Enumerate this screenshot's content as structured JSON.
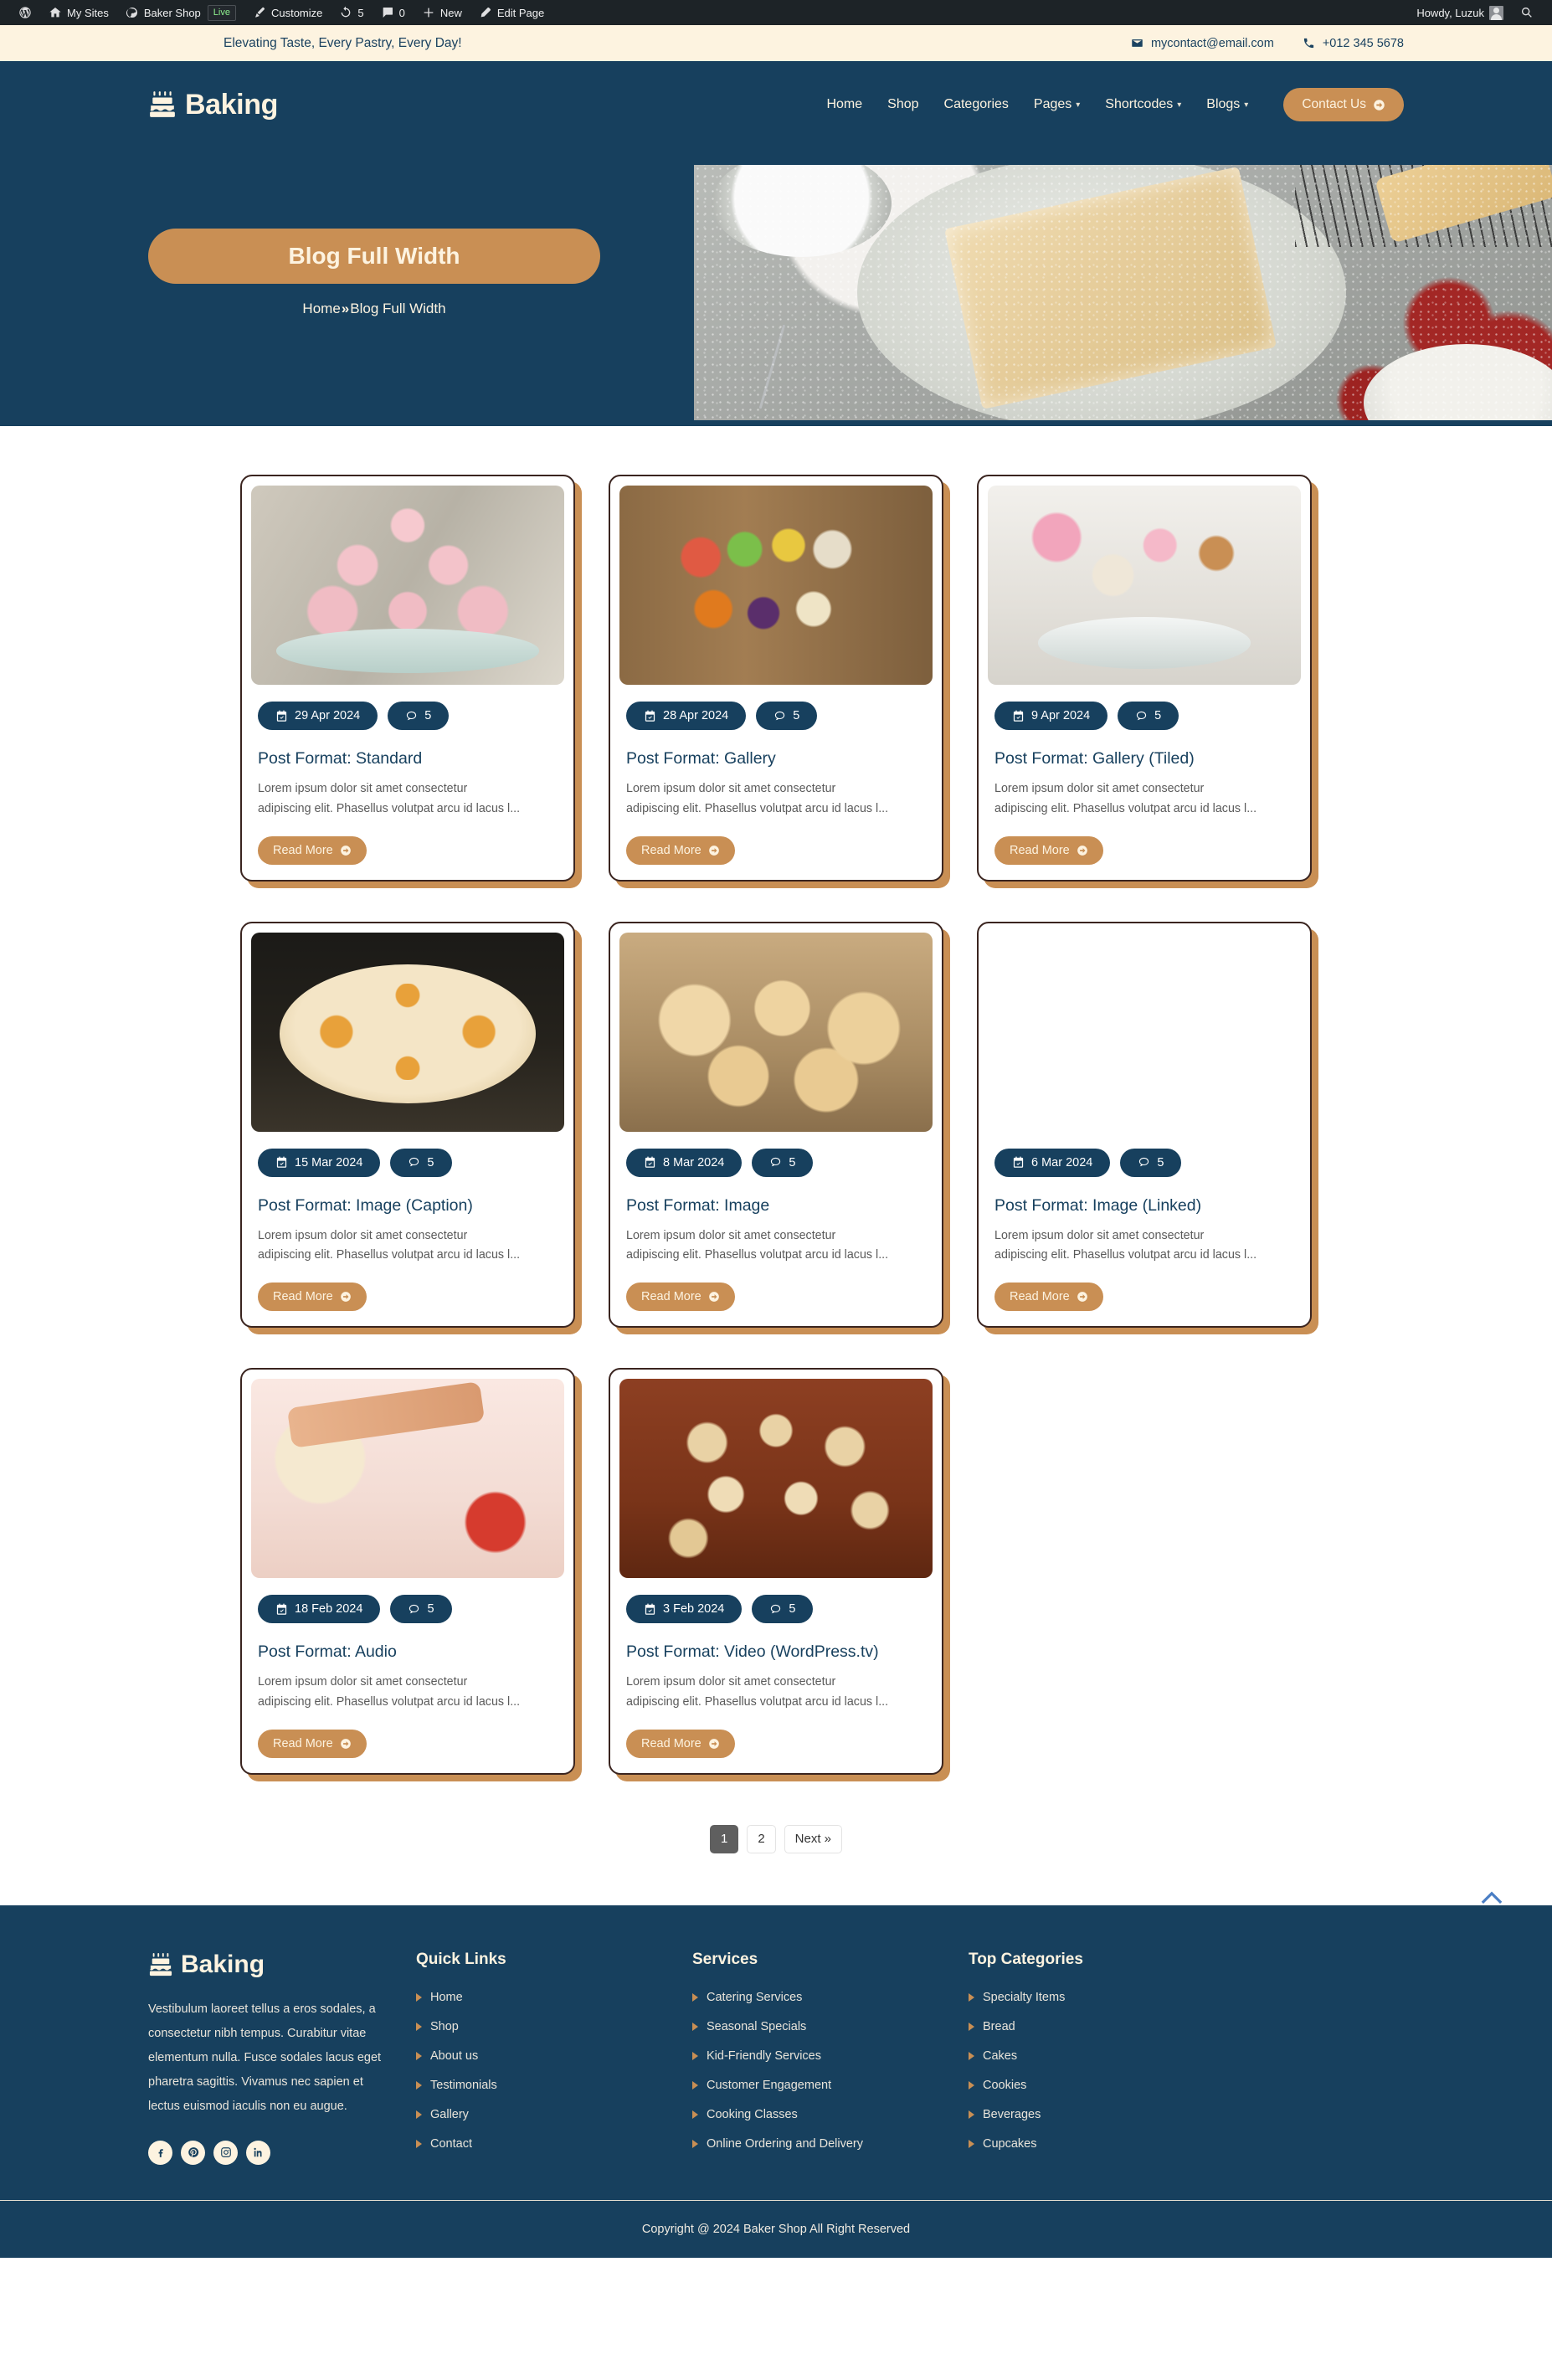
{
  "adminbar": {
    "items": [
      {
        "name": "wordpress-logo",
        "label": ""
      },
      {
        "name": "my-sites",
        "label": "My Sites"
      },
      {
        "name": "site-name",
        "label": "Baker Shop"
      },
      {
        "name": "live-badge",
        "label": "Live"
      },
      {
        "name": "customize",
        "label": "Customize"
      },
      {
        "name": "updates",
        "label": "5"
      },
      {
        "name": "comments",
        "label": "0"
      },
      {
        "name": "new",
        "label": "New"
      },
      {
        "name": "edit-page",
        "label": "Edit Page"
      }
    ],
    "howdy": "Howdy, Luzuk"
  },
  "topbar": {
    "tagline": "Elevating Taste, Every Pastry, Every Day!",
    "email": "mycontact@email.com",
    "phone": "+012 345 5678"
  },
  "header": {
    "brand": "Baking",
    "nav": [
      {
        "label": "Home",
        "has_caret": false
      },
      {
        "label": "Shop",
        "has_caret": false
      },
      {
        "label": "Categories",
        "has_caret": false
      },
      {
        "label": "Pages",
        "has_caret": true
      },
      {
        "label": "Shortcodes",
        "has_caret": true
      },
      {
        "label": "Blogs",
        "has_caret": true
      }
    ],
    "cta": "Contact Us"
  },
  "hero": {
    "title": "Blog Full Width",
    "breadcrumb_home": "Home",
    "breadcrumb_sep": "»",
    "breadcrumb_current": "Blog Full Width"
  },
  "posts": [
    {
      "date": "29 Apr 2024",
      "comments": "5",
      "title": "Post Format: Standard",
      "excerpt": "Lorem ipsum dolor sit amet consectetur adipiscing elit. Phasellus volutpat arcu id lacus l...",
      "read_more": "Read More",
      "photo": "ph-cupcakes"
    },
    {
      "date": "28 Apr 2024",
      "comments": "5",
      "title": "Post Format: Gallery",
      "excerpt": "Lorem ipsum dolor sit amet consectetur adipiscing elit. Phasellus volutpat arcu id lacus l...",
      "read_more": "Read More",
      "photo": "ph-macaron"
    },
    {
      "date": "9 Apr 2024",
      "comments": "5",
      "title": "Post Format: Gallery (Tiled)",
      "excerpt": "Lorem ipsum dolor sit amet consectetur adipiscing elit. Phasellus volutpat arcu id lacus l...",
      "read_more": "Read More",
      "photo": "ph-tiled"
    },
    {
      "date": "15 Mar 2024",
      "comments": "5",
      "title": "Post Format: Image (Caption)",
      "excerpt": "Lorem ipsum dolor sit amet consectetur adipiscing elit. Phasellus volutpat arcu id lacus l...",
      "read_more": "Read More",
      "photo": "ph-cake"
    },
    {
      "date": "8 Mar 2024",
      "comments": "5",
      "title": "Post Format: Image",
      "excerpt": "Lorem ipsum dolor sit amet consectetur adipiscing elit. Phasellus volutpat arcu id lacus l...",
      "read_more": "Read More",
      "photo": "ph-pastry"
    },
    {
      "date": "6 Mar 2024",
      "comments": "5",
      "title": "Post Format: Image (Linked)",
      "excerpt": "Lorem ipsum dolor sit amet consectetur adipiscing elit. Phasellus volutpat arcu id lacus l...",
      "read_more": "Read More",
      "photo": "ph-blue"
    },
    {
      "date": "18 Feb 2024",
      "comments": "5",
      "title": "Post Format: Audio",
      "excerpt": "Lorem ipsum dolor sit amet consectetur adipiscing elit. Phasellus volutpat arcu id lacus l...",
      "read_more": "Read More",
      "photo": "ph-dough"
    },
    {
      "date": "3 Feb 2024",
      "comments": "5",
      "title": "Post Format: Video (WordPress.tv)",
      "excerpt": "Lorem ipsum dolor sit amet consectetur adipiscing elit. Phasellus volutpat arcu id lacus l...",
      "read_more": "Read More",
      "photo": "ph-cookies"
    }
  ],
  "pagination": {
    "pages": [
      "1",
      "2"
    ],
    "active": "1",
    "next": "Next »"
  },
  "footer": {
    "brand": "Baking",
    "about": "Vestibulum laoreet tellus a eros sodales, a consectetur nibh tempus. Curabitur vitae elementum nulla. Fusce sodales lacus eget pharetra sagittis. Vivamus nec sapien et lectus euismod iaculis non eu augue.",
    "socials": [
      "facebook-icon",
      "pinterest-icon",
      "instagram-icon",
      "linkedin-icon"
    ],
    "columns": [
      {
        "heading": "Quick Links",
        "links": [
          "Home",
          "Shop",
          "About us",
          "Testimonials",
          "Gallery",
          "Contact"
        ]
      },
      {
        "heading": "Services",
        "links": [
          "Catering Services",
          "Seasonal Specials",
          "Kid-Friendly Services",
          "Customer Engagement",
          "Cooking Classes",
          "Online Ordering and Delivery"
        ]
      },
      {
        "heading": "Top Categories",
        "links": [
          "Specialty Items",
          "Bread",
          "Cakes",
          "Cookies",
          "Beverages",
          "Cupcakes"
        ]
      }
    ],
    "copyright": "Copyright @ 2024 Baker Shop All Right Reserved"
  },
  "colors": {
    "navy": "#17405e",
    "tan": "#c98f54",
    "cream": "#fdf3e0",
    "card_border": "#3a241f",
    "admin_bar": "#1d2327"
  }
}
